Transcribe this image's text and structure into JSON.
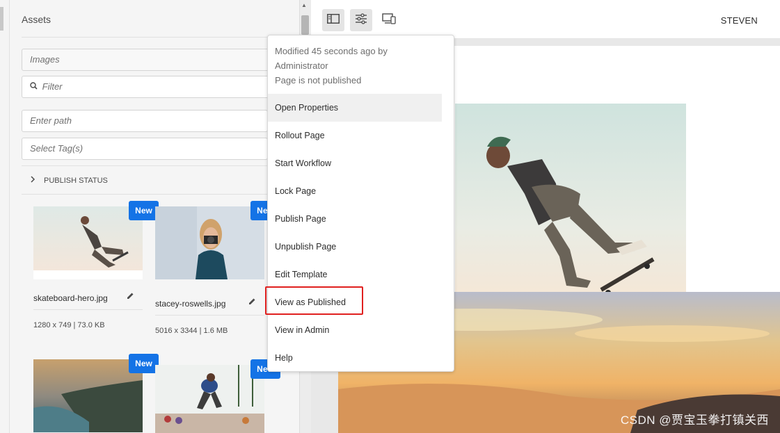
{
  "assets_panel": {
    "title": "Assets",
    "asset_type": "Images",
    "filter_placeholder": "Filter",
    "path_placeholder": "Enter path",
    "tags_placeholder": "Select Tag(s)",
    "publish_status_label": "PUBLISH STATUS",
    "cards": [
      {
        "badge": "New",
        "name": "skateboard-hero.jpg",
        "meta": "1280 x 749 | 73.0 KB"
      },
      {
        "badge": "New",
        "name": "stacey-roswells.jpg",
        "meta": "5016 x 3344 | 1.6 MB"
      },
      {
        "badge": "New"
      },
      {
        "badge": "New"
      }
    ]
  },
  "toolbar": {
    "user": "STEVEN",
    "icons": [
      "side-panel-icon",
      "page-properties-icon",
      "emulator-icon"
    ]
  },
  "page_info_popover": {
    "info": {
      "modified": "Modified 45 seconds ago by",
      "by": "Administrator",
      "status": "Page is not published"
    },
    "items": [
      "Open Properties",
      "Rollout Page",
      "Start Workflow",
      "Lock Page",
      "Publish Page",
      "Unpublish Page",
      "Edit Template",
      "View as Published",
      "View in Admin",
      "Help"
    ],
    "highlighted_item": "View as Published"
  },
  "watermark": "CSDN @贾宝玉拳打镇关西",
  "colors": {
    "accent": "#1473e6",
    "highlight": "#e0201f"
  }
}
